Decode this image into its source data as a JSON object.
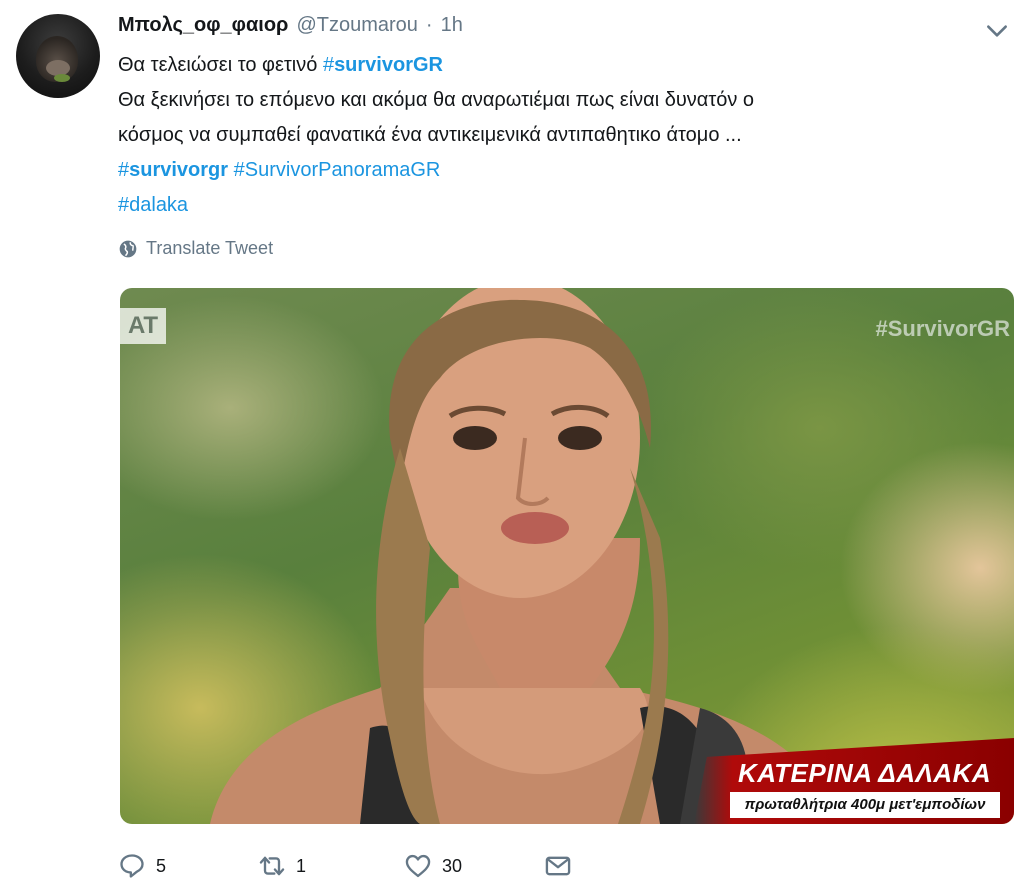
{
  "tweet": {
    "author_name": "Μπολς_οφ_φαιορ",
    "handle": "@Tzoumarou",
    "separator": "·",
    "time": "1h",
    "line1_text": "Θα τελειώσει το φετινό ",
    "line1_hashtag_symbol": "#",
    "line1_hashtag": "survivorGR",
    "line2": "Θα ξεκινήσει το επόμενο και ακόμα θα αναρωτιέμαι πως είναι δυνατόν ο",
    "line3": "κόσμος να συμπαθεί φανατικά ένα αντικειμενικά αντιπαθητικο άτομο ...",
    "line4_hashtag1_symbol": "#",
    "line4_hashtag1": "survivorgr",
    "line4_hashtag2": "#SurvivorPanoramaGR",
    "line5_hashtag": "#dalaka",
    "translate_label": "Translate Tweet"
  },
  "media": {
    "channel_logo": "ΑΤ",
    "watermark": "#SurvivorGR",
    "caption_name": "ΚΑΤΕΡΙΝΑ ΔΑΛΑΚΑ",
    "caption_subtitle": "πρωταθλήτρια 400μ μετ'εμποδίων"
  },
  "actions": {
    "reply_count": "5",
    "retweet_count": "1",
    "like_count": "30"
  },
  "icons": {
    "chevron": "chevron-down-icon",
    "globe": "globe-icon",
    "reply": "reply-icon",
    "retweet": "retweet-icon",
    "like": "heart-icon",
    "message": "envelope-icon"
  },
  "colors": {
    "link": "#1b95e0",
    "muted": "#657786",
    "text": "#14171a"
  }
}
